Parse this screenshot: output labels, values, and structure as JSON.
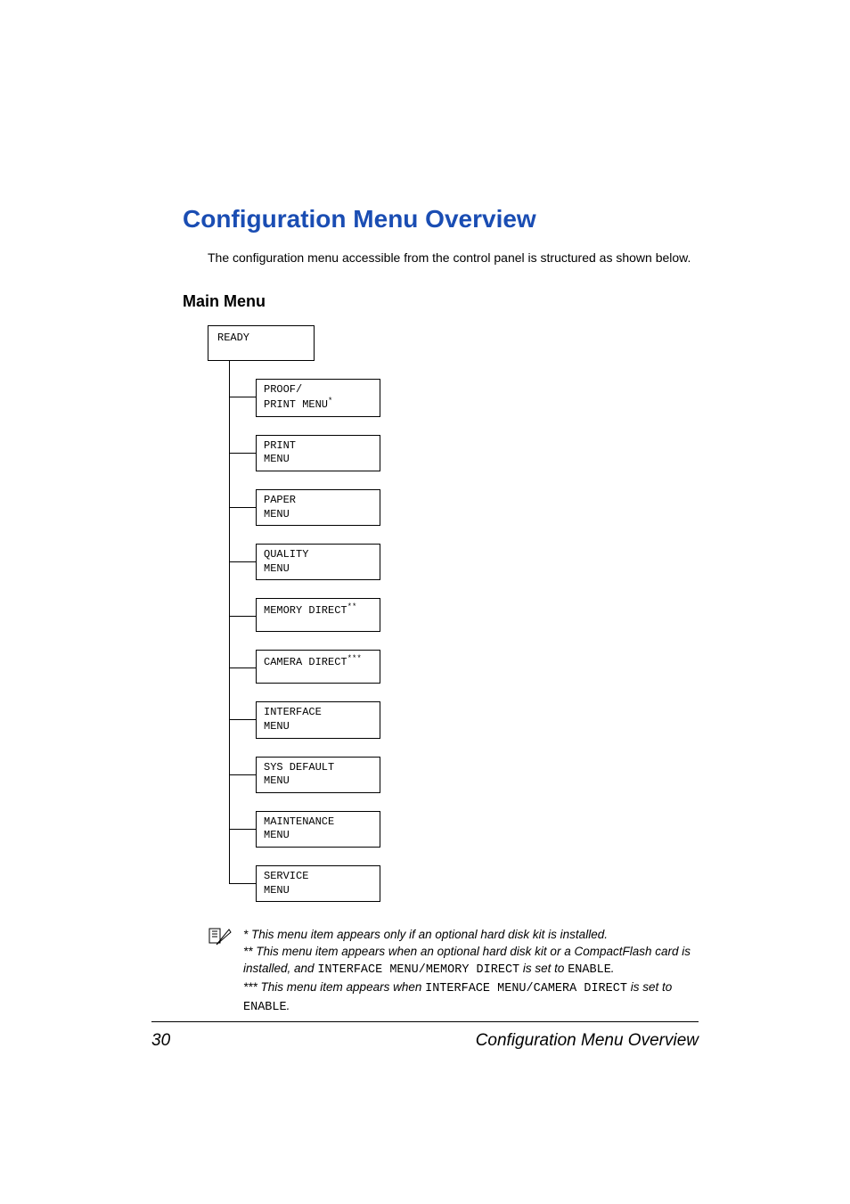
{
  "heading1": "Configuration Menu Overview",
  "intro": "The configuration menu accessible from the control panel is structured as shown below.",
  "heading2": "Main Menu",
  "ready": "READY",
  "menu_items": [
    {
      "line1": "PROOF/",
      "line2": "PRINT MENU",
      "sup": "*"
    },
    {
      "line1": "PRINT",
      "line2": "MENU",
      "sup": ""
    },
    {
      "line1": "PAPER",
      "line2": "MENU",
      "sup": ""
    },
    {
      "line1": "QUALITY",
      "line2": "MENU",
      "sup": ""
    },
    {
      "line1": "MEMORY DIRECT",
      "line2": "",
      "sup": "**"
    },
    {
      "line1": "CAMERA DIRECT",
      "line2": "",
      "sup": "***"
    },
    {
      "line1": "INTERFACE",
      "line2": "MENU",
      "sup": ""
    },
    {
      "line1": "SYS DEFAULT",
      "line2": "MENU",
      "sup": ""
    },
    {
      "line1": "MAINTENANCE",
      "line2": "MENU",
      "sup": ""
    },
    {
      "line1": "SERVICE",
      "line2": "MENU",
      "sup": ""
    }
  ],
  "note": {
    "n1": "* This menu item appears only if an optional hard disk kit is installed.",
    "n2a": "** This menu item appears when an optional hard disk kit or a CompactFlash card is installed, and ",
    "n2code": "INTERFACE MENU/MEMORY DIRECT",
    "n2b": " is set to ",
    "n2enable": "ENABLE",
    "n2c": ".",
    "n3a": "*** This menu item appears when ",
    "n3code": "INTERFACE MENU/CAMERA DIRECT",
    "n3b": " is set to ",
    "n3enable": "ENABLE",
    "n3c": "."
  },
  "footer": {
    "page": "30",
    "title": "Configuration Menu Overview"
  }
}
